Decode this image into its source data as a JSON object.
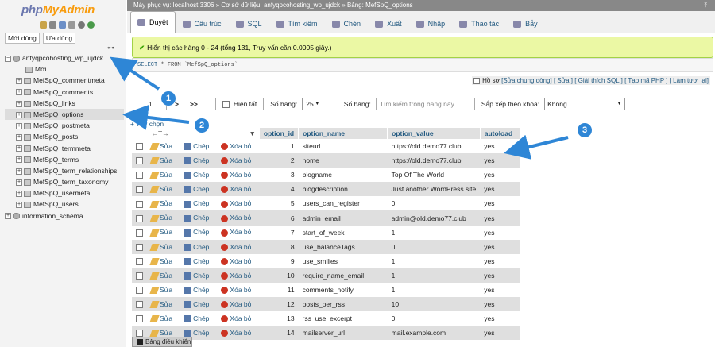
{
  "sidebar": {
    "logo_php": "php",
    "logo_admin": "MyAdmin",
    "recent_tab": "Mới dùng",
    "favorite_tab": "Ưa dùng",
    "tree": [
      {
        "label": "anfyqpcohosting_wp_ujdck",
        "type": "db"
      },
      {
        "label": "Mới",
        "type": "new"
      },
      {
        "label": "MefSpQ_commentmeta",
        "type": "table"
      },
      {
        "label": "MefSpQ_comments",
        "type": "table"
      },
      {
        "label": "MefSpQ_links",
        "type": "table"
      },
      {
        "label": "MefSpQ_options",
        "type": "table",
        "selected": true
      },
      {
        "label": "MefSpQ_postmeta",
        "type": "table"
      },
      {
        "label": "MefSpQ_posts",
        "type": "table"
      },
      {
        "label": "MefSpQ_termmeta",
        "type": "table"
      },
      {
        "label": "MefSpQ_terms",
        "type": "table"
      },
      {
        "label": "MefSpQ_term_relationships",
        "type": "table"
      },
      {
        "label": "MefSpQ_term_taxonomy",
        "type": "table"
      },
      {
        "label": "MefSpQ_usermeta",
        "type": "table"
      },
      {
        "label": "MefSpQ_users",
        "type": "table"
      },
      {
        "label": "information_schema",
        "type": "db"
      }
    ]
  },
  "breadcrumb": {
    "server": "Máy phục vụ: localhost:3306",
    "database": "Cơ sở dữ liệu: anfyqpcohosting_wp_ujdck",
    "table": "Bảng: MefSpQ_options"
  },
  "tabs": [
    "Duyệt",
    "Cấu trúc",
    "SQL",
    "Tìm kiếm",
    "Chèn",
    "Xuất",
    "Nhập",
    "Thao tác",
    "Bẫy"
  ],
  "message": "Hiển thị các hàng 0 - 24 (tổng 131, Truy vấn cần 0.0005 giây.)",
  "sql": {
    "kw1": "SELECT",
    "rest": " * FROM `MefSpQ_options`"
  },
  "sql_links": {
    "profiling": "Hồ sơ",
    "edit_inline": "[Sửa chung dòng]",
    "edit": "[ Sửa ]",
    "explain": "[ Giải thích SQL ]",
    "php_code": "[ Tạo mã PHP ]",
    "refresh": "[ Làm tươi lại]"
  },
  "nav": {
    "page": "1",
    "next": ">",
    "last": ">>",
    "show_all": "Hiện tất",
    "rows_label": "Số hàng:",
    "rows_value": "25",
    "filter_label": "Số hàng:",
    "filter_placeholder": "Tìm kiếm trong bảng này",
    "sort_label": "Sắp xếp theo khóa:",
    "sort_value": "Không"
  },
  "options_link": "+ Tùy chọn",
  "arrows_text": "←T→",
  "columns": [
    "option_id",
    "option_name",
    "option_value",
    "autoload"
  ],
  "actions": {
    "edit": "Sửa",
    "copy": "Chép",
    "delete": "Xóa bỏ"
  },
  "rows": [
    {
      "id": "1",
      "name": "siteurl",
      "value": "https://old.demo77.club",
      "autoload": "yes"
    },
    {
      "id": "2",
      "name": "home",
      "value": "https://old.demo77.club",
      "autoload": "yes"
    },
    {
      "id": "3",
      "name": "blogname",
      "value": "Top Of The World",
      "autoload": "yes"
    },
    {
      "id": "4",
      "name": "blogdescription",
      "value": "Just another WordPress site",
      "autoload": "yes"
    },
    {
      "id": "5",
      "name": "users_can_register",
      "value": "0",
      "autoload": "yes"
    },
    {
      "id": "6",
      "name": "admin_email",
      "value": "admin@old.demo77.club",
      "autoload": "yes"
    },
    {
      "id": "7",
      "name": "start_of_week",
      "value": "1",
      "autoload": "yes"
    },
    {
      "id": "8",
      "name": "use_balanceTags",
      "value": "0",
      "autoload": "yes"
    },
    {
      "id": "9",
      "name": "use_smilies",
      "value": "1",
      "autoload": "yes"
    },
    {
      "id": "10",
      "name": "require_name_email",
      "value": "1",
      "autoload": "yes"
    },
    {
      "id": "11",
      "name": "comments_notify",
      "value": "1",
      "autoload": "yes"
    },
    {
      "id": "12",
      "name": "posts_per_rss",
      "value": "10",
      "autoload": "yes"
    },
    {
      "id": "13",
      "name": "rss_use_excerpt",
      "value": "0",
      "autoload": "yes"
    },
    {
      "id": "14",
      "name": "mailserver_url",
      "value": "mail.example.com",
      "autoload": "yes"
    }
  ],
  "console": "Bảng điều khiển",
  "annotations": [
    "1",
    "2",
    "3"
  ],
  "colors": {
    "accent": "#2e86d6",
    "link": "#235a81",
    "success_bg": "#ebf8a4"
  }
}
